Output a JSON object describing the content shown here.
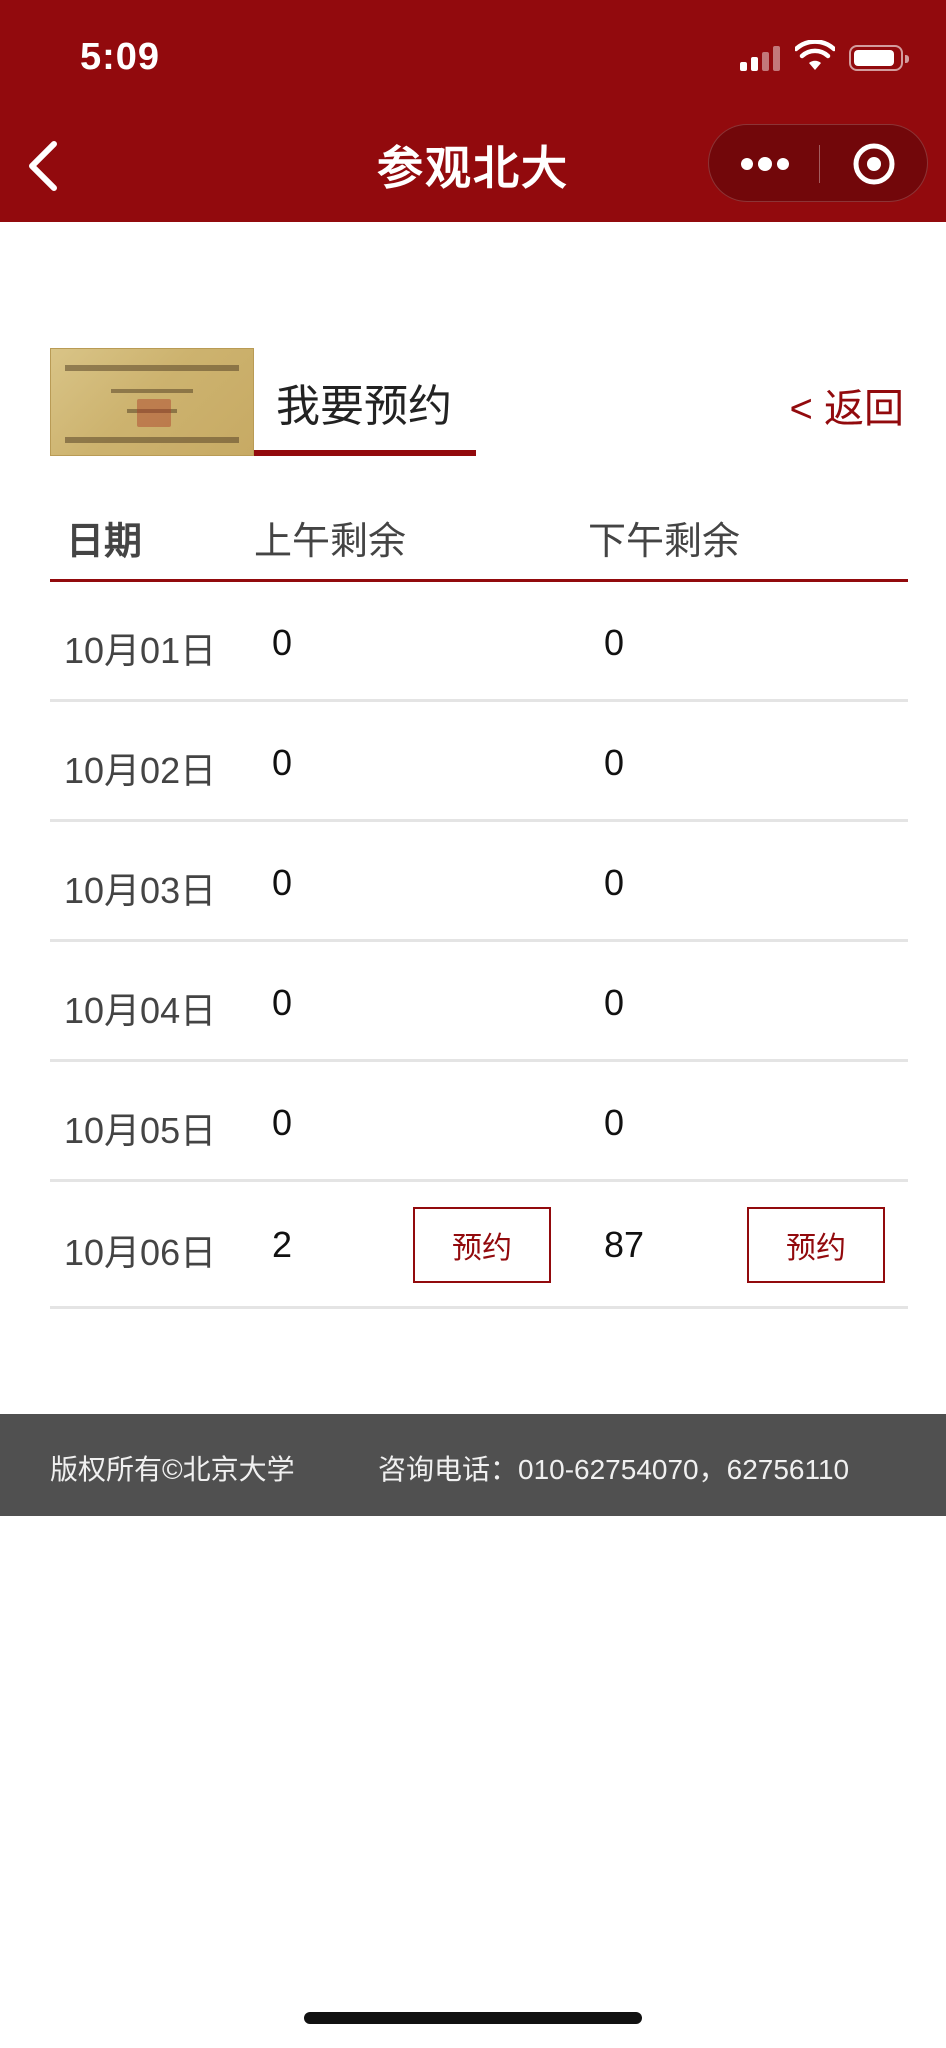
{
  "status_bar": {
    "time": "5:09"
  },
  "nav": {
    "title": "参观北大"
  },
  "header": {
    "title": "我要预约",
    "return_label": "< 返回"
  },
  "table": {
    "headers": {
      "date": "日期",
      "am": "上午剩余",
      "pm": "下午剩余"
    },
    "rows": [
      {
        "date": "10月01日",
        "am": "0",
        "pm": "0"
      },
      {
        "date": "10月02日",
        "am": "0",
        "pm": "0"
      },
      {
        "date": "10月03日",
        "am": "0",
        "pm": "0"
      },
      {
        "date": "10月04日",
        "am": "0",
        "pm": "0"
      },
      {
        "date": "10月05日",
        "am": "0",
        "pm": "0"
      },
      {
        "date": "10月06日",
        "am": "2",
        "pm": "87",
        "am_button": "预约",
        "pm_button": "预约"
      }
    ]
  },
  "footer": {
    "copyright": "版权所有©北京大学",
    "phone": "咨询电话：010-62754070，62756110"
  },
  "colors": {
    "brand": "#920a0d",
    "footer_bg": "#505050",
    "row_divider": "#e4e4e4"
  },
  "icons": [
    "back-chevron-icon",
    "more-dots-icon",
    "target-icon",
    "signal-icon",
    "wifi-icon",
    "battery-icon"
  ]
}
